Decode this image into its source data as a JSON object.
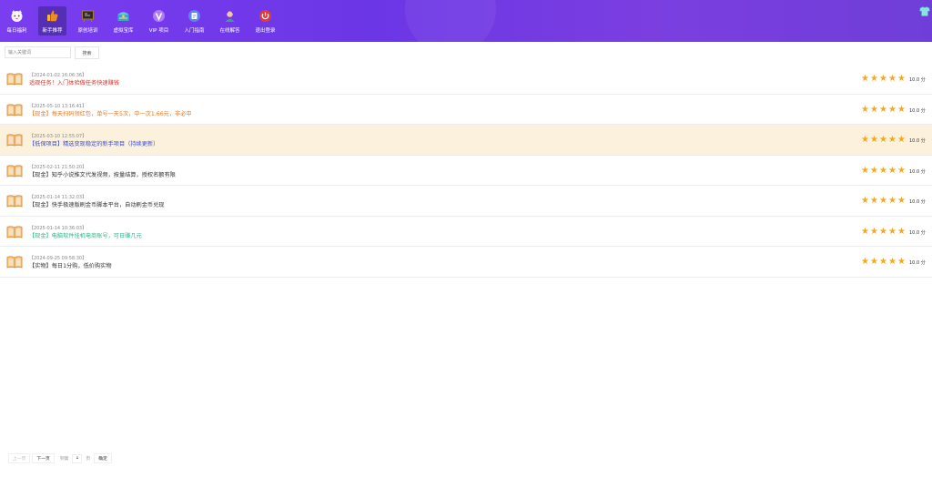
{
  "nav": {
    "items": [
      {
        "label": "每日福利",
        "icon": "cat-face-icon",
        "color": "#ffffff"
      },
      {
        "label": "新手推荐",
        "icon": "thumbs-up-icon",
        "color": "#f5a623"
      },
      {
        "label": "原创培训",
        "icon": "blackboard-icon",
        "color": "#6b4a2b"
      },
      {
        "label": "虚拟宝库",
        "icon": "treasure-chest-icon",
        "color": "#3cb8d9"
      },
      {
        "label": "VIP 项目",
        "icon": "vip-icon",
        "color": "#a66cf0"
      },
      {
        "label": "入门指南",
        "icon": "guide-icon",
        "color": "#5b7cf5"
      },
      {
        "label": "在线解答",
        "icon": "support-agent-icon",
        "color": "#e86a3a"
      },
      {
        "label": "退出登录",
        "icon": "power-icon",
        "color": "#e23a3a"
      }
    ]
  },
  "search": {
    "placeholder": "输入关键词",
    "button_label": "搜索"
  },
  "list": [
    {
      "time": "【2024-01-02 16:06:36】",
      "title": "适观任务！入门体验做任务快速赚钱",
      "title_color": "#d0352f",
      "rating": 5,
      "score": "10.0 分"
    },
    {
      "time": "【2025-05-10 13:16:41】",
      "title": "【现金】每天扫码领红包，单号一天5次，中一次1.66元，非必中",
      "title_color": "#e07b2c",
      "rating": 5,
      "score": "10.0 分"
    },
    {
      "time": "【2025-03-10 12:55:07】",
      "title": "【低保项目】精选变现稳定的新手项目（持续更新）",
      "title_color": "#3b4bd8",
      "rating": 5,
      "score": "10.0 分"
    },
    {
      "time": "【2025-02-11 21:50:20】",
      "title": "【现金】知乎小说推文代发视频，按量结算，授权名额有限",
      "title_color": "#333333",
      "rating": 5,
      "score": "10.0 分"
    },
    {
      "time": "【2025-01-14 11:32:03】",
      "title": "【现金】快手极速版刷金币脚本平台，自动刷金币兑现",
      "title_color": "#333333",
      "rating": 5,
      "score": "10.0 分"
    },
    {
      "time": "【2025-01-14 10:36:03】",
      "title": "【现金】电脑软件挂机电商账号，可日赚几元",
      "title_color": "#2fb58a",
      "rating": 5,
      "score": "10.0 分"
    },
    {
      "time": "【2024-09-25 09:58:30】",
      "title": "【实物】每日1分购，低价购实物",
      "title_color": "#333333",
      "rating": 5,
      "score": "10.0 分"
    }
  ],
  "highlight_row": 2,
  "pager": {
    "prev_label": "上一页",
    "next_label": "下一页",
    "goto_label": "到第",
    "page_value": "1",
    "page_unit": "页",
    "confirm_label": "确定"
  },
  "colors": {
    "header_gradient_start": "#7a3df0",
    "header_gradient_end": "#6f3ed8",
    "star": "#f4a81b",
    "highlight_row_bg": "#fcf1dc"
  }
}
